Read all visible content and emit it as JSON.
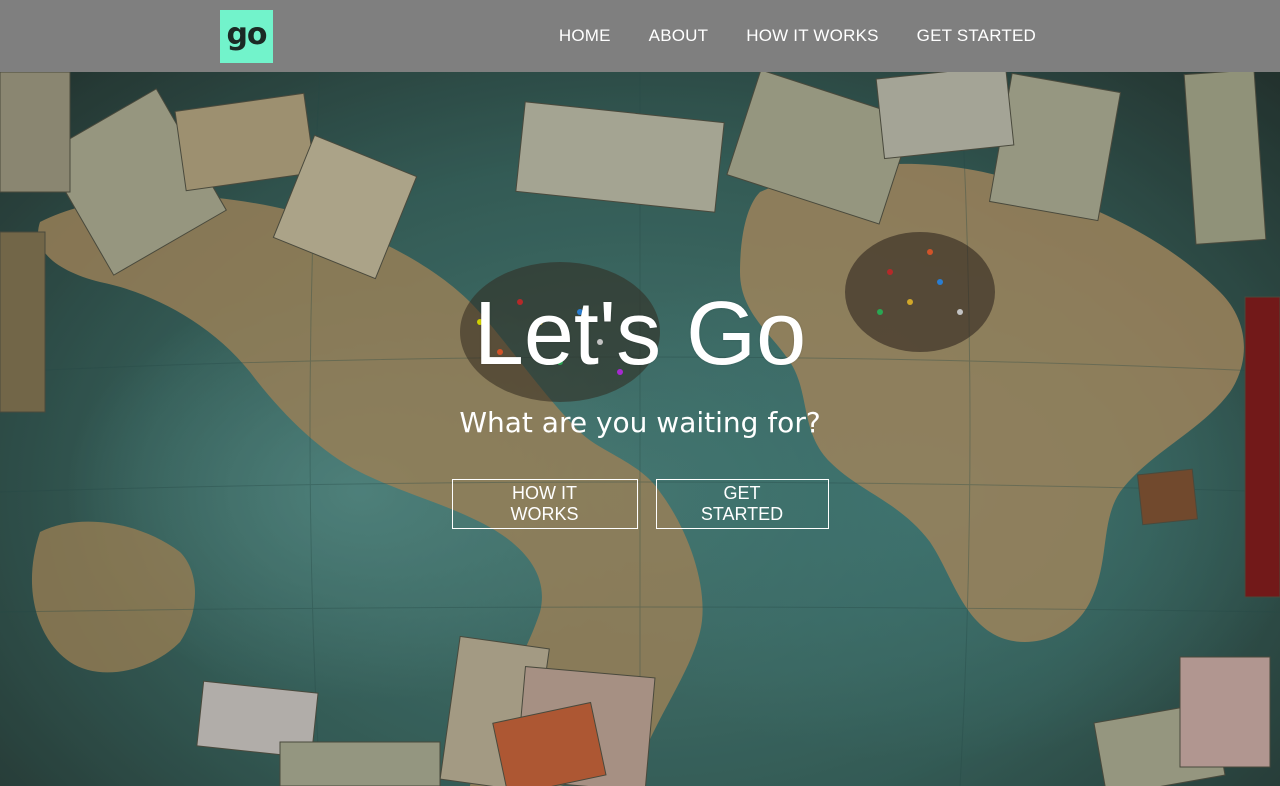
{
  "header": {
    "logo_text": "go",
    "nav": [
      {
        "label": "HOME"
      },
      {
        "label": "ABOUT"
      },
      {
        "label": "HOW IT WORKS"
      },
      {
        "label": "GET STARTED"
      }
    ]
  },
  "hero": {
    "title": "Let's Go",
    "subtitle": "What are you waiting for?",
    "buttons": [
      {
        "label": "HOW IT WORKS"
      },
      {
        "label": "GET STARTED"
      }
    ],
    "background": "world-map-with-banknotes-and-pins"
  },
  "colors": {
    "navbar_bg": "#7f7f7f",
    "logo_bg": "#72f3cb",
    "text": "#ffffff"
  }
}
